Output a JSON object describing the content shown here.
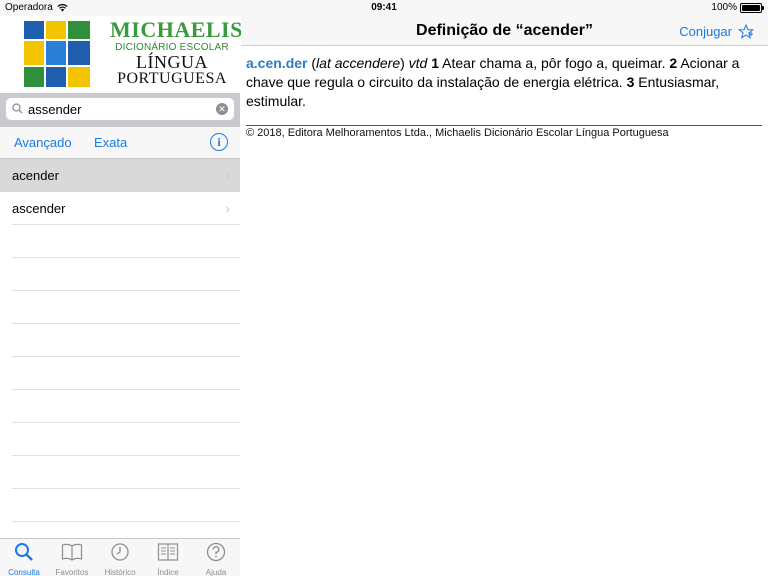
{
  "status": {
    "carrier": "Operadora",
    "time": "09:41",
    "battery": "100%"
  },
  "brand": {
    "line1": "MICHAELIS",
    "line2": "DICIONÁRIO ESCOLAR",
    "line3": "LÍNGUA",
    "line4": "PORTUGUESA"
  },
  "search": {
    "value": "assender",
    "placeholder": ""
  },
  "modes": {
    "advanced": "Avançado",
    "exact": "Exata"
  },
  "results": [
    {
      "label": "acender",
      "selected": true
    },
    {
      "label": "ascender",
      "selected": false
    }
  ],
  "tabs": [
    {
      "label": "Consulta",
      "icon": "search-icon",
      "active": true
    },
    {
      "label": "Favoritos",
      "icon": "book-icon",
      "active": false
    },
    {
      "label": "Histórico",
      "icon": "clock-icon",
      "active": false
    },
    {
      "label": "Índice",
      "icon": "index-icon",
      "active": false
    },
    {
      "label": "Ajuda",
      "icon": "help-icon",
      "active": false
    }
  ],
  "navbar": {
    "title": "Definição de “acender”",
    "conjugate": "Conjugar"
  },
  "definition": {
    "headword": "a.cen.der",
    "etym_open": " (",
    "etym": "lat accendere",
    "etym_close": ") ",
    "pos": "vtd",
    "sense1_num": " 1",
    "sense1": " Atear chama a, pôr fogo a, queimar.",
    "sense2_num": " 2",
    "sense2": " Acionar a chave que regula o circuito da instalação de energia elétrica.",
    "sense3_num": " 3",
    "sense3": " Entusiasmar, estimular."
  },
  "copyright": "© 2018, Editora Melhoramentos Ltda., Michaelis Dicionário Escolar Língua Portuguesa",
  "colors": {
    "accent": "#1a7ae6",
    "headword": "#2e7cc4",
    "brand_green": "#3a9a3e"
  }
}
